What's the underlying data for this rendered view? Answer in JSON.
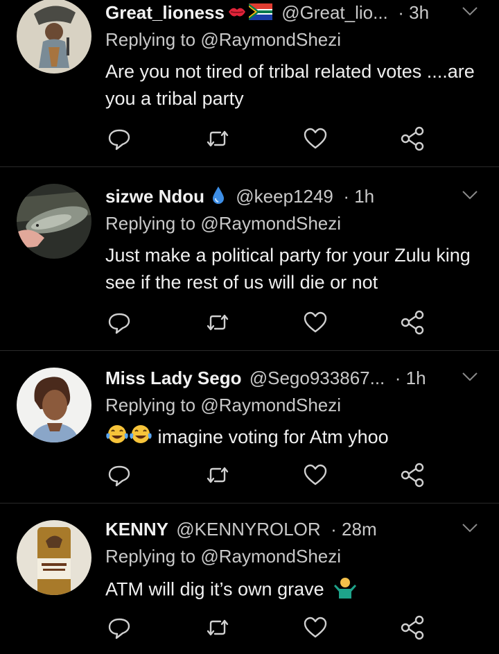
{
  "tweets": [
    {
      "name": "Great_lioness",
      "handle": "@Great_lio...",
      "time": "3h",
      "reply_prefix": "Replying to",
      "reply_to": "@RaymondShezi",
      "text": "Are you not tired of tribal related votes ....are you a tribal party",
      "badges": [
        "kiss-mark-emoji",
        "south-africa-flag-emoji"
      ]
    },
    {
      "name": "sizwe Ndou",
      "handle": "@keep1249",
      "time": "1h",
      "reply_prefix": "Replying to",
      "reply_to": "@RaymondShezi",
      "text": "Just make a political party for your Zulu king see if the rest of us will die or not",
      "badges": [
        "droplet-emoji"
      ]
    },
    {
      "name": "Miss Lady Sego",
      "handle": "@Sego933867...",
      "time": "1h",
      "reply_prefix": "Replying to",
      "reply_to": "@RaymondShezi",
      "text": "imagine voting for Atm yhoo",
      "badges": [
        "tears-of-joy-emoji",
        "tears-of-joy-emoji"
      ]
    },
    {
      "name": "KENNY",
      "handle": "@KENNYROLOR",
      "time": "28m",
      "reply_prefix": "Replying to",
      "reply_to": "@RaymondShezi",
      "text": "ATM will dig it’s own grave",
      "badges": [
        "person-shrugging-emoji"
      ]
    }
  ],
  "colors": {
    "background": "#000000",
    "primary_text": "#f0f0f0",
    "secondary_text": "#c9c9c9",
    "divider": "#2a2a2a"
  },
  "icons": [
    "reply-icon",
    "retweet-icon",
    "like-icon",
    "share-icon",
    "chevron-down-icon"
  ]
}
